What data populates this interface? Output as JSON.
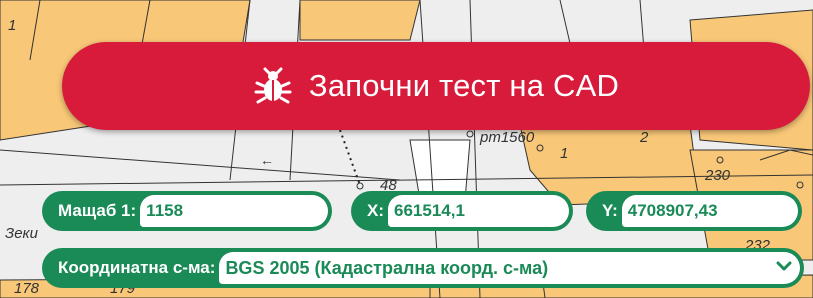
{
  "action": {
    "label": "Започни тест на CAD",
    "icon": "bug-icon",
    "color": "#d81b3b"
  },
  "coords": {
    "scale": {
      "label": "Мащаб 1:",
      "value": "1158"
    },
    "x": {
      "label": "X:",
      "value": "661514,1"
    },
    "y": {
      "label": "Y:",
      "value": "4708907,43"
    },
    "system": {
      "label": "Координатна с-ма:",
      "value": "BGS 2005 (Кадастрална коорд. с-ма)"
    },
    "accent": "#1a8a57"
  },
  "map_labels": {
    "l1": "1",
    "l2": "рт1560",
    "l3": "2",
    "l4": "1",
    "l5": "230",
    "l6": "232",
    "l7": "2",
    "l8": "Зеки",
    "l9": "178",
    "l10": "179",
    "l11": "48"
  }
}
